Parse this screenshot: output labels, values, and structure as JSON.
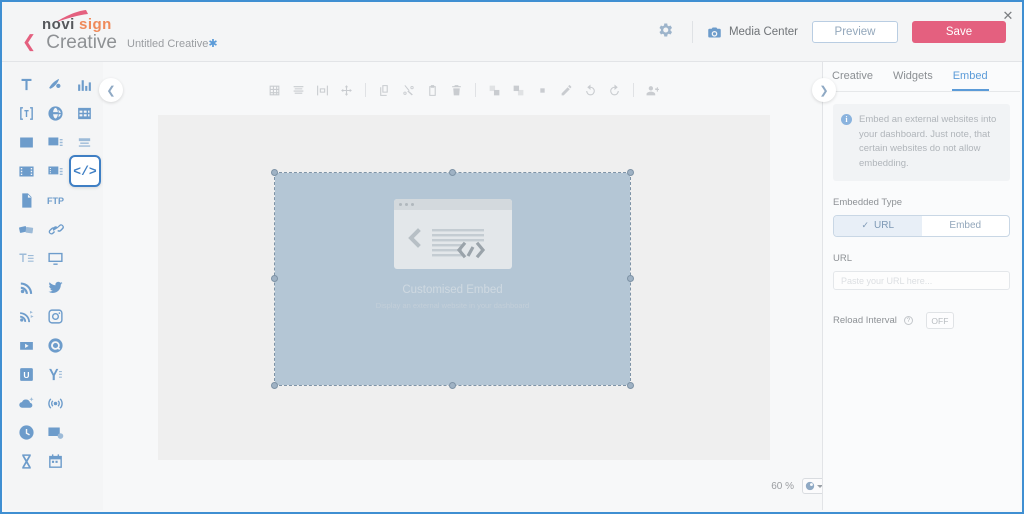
{
  "window": {
    "close_label": "✕",
    "accent_blue": "#3f8fd2",
    "accent_pink": "#e4607f"
  },
  "header": {
    "logo_primary": "novi",
    "logo_secondary": "sign",
    "back_chevron": "❮",
    "title": "Creative",
    "doc_name": "Untitled Creative",
    "doc_modified_mark": "✱",
    "gear_icon": "gear-icon",
    "media_center_label": "Media Center",
    "media_center_icon": "camera-icon",
    "preview_label": "Preview",
    "save_label": "Save"
  },
  "sidebar": {
    "items": [
      {
        "name": "text-widget",
        "icon": "text-icon",
        "selected": false
      },
      {
        "name": "paint-widget",
        "icon": "paint-icon",
        "selected": false
      },
      {
        "name": "chart-widget",
        "icon": "chart-icon",
        "selected": false
      },
      {
        "name": "text3d-widget",
        "icon": "text-3d-icon",
        "selected": false
      },
      {
        "name": "web-widget",
        "icon": "globe-icon",
        "selected": false
      },
      {
        "name": "table-widget",
        "icon": "table-icon",
        "selected": false
      },
      {
        "name": "image-widget",
        "icon": "image-icon",
        "selected": false
      },
      {
        "name": "slideshow-widget",
        "icon": "slideshow-icon",
        "selected": false
      },
      {
        "name": "banner-widget",
        "icon": "banner-icon",
        "selected": false
      },
      {
        "name": "video-widget",
        "icon": "video-icon",
        "selected": false
      },
      {
        "name": "video-playlist-widget",
        "icon": "video-playlist-icon",
        "selected": false
      },
      {
        "name": "embed-widget",
        "icon": "code-icon",
        "glyph": "</>",
        "selected": true
      },
      {
        "name": "document-widget",
        "icon": "document-icon",
        "selected": false
      },
      {
        "name": "ftp-widget",
        "icon": "ftp-icon",
        "glyph": "FTP",
        "selected": false
      },
      {
        "name": "cards-widget",
        "icon": "cards-icon",
        "selected": false
      },
      {
        "name": "link-widget",
        "icon": "link-icon",
        "selected": false
      },
      {
        "name": "ticker-widget",
        "icon": "ticker-text-icon",
        "selected": false
      },
      {
        "name": "screen-widget",
        "icon": "monitor-icon",
        "selected": false
      },
      {
        "name": "rss-widget",
        "icon": "rss-icon",
        "selected": false
      },
      {
        "name": "twitter-widget",
        "icon": "twitter-icon",
        "selected": false
      },
      {
        "name": "rss-feed-widget",
        "icon": "rss-alt-icon",
        "selected": false
      },
      {
        "name": "instagram-widget",
        "icon": "instagram-icon",
        "selected": false
      },
      {
        "name": "youtube-widget",
        "icon": "youtube-icon",
        "selected": false
      },
      {
        "name": "quora-widget",
        "icon": "quora-icon",
        "selected": false
      },
      {
        "name": "untappd-widget",
        "icon": "untappd-icon",
        "glyph": "U",
        "selected": false
      },
      {
        "name": "yammer-widget",
        "icon": "yammer-icon",
        "glyph": "y",
        "selected": false
      },
      {
        "name": "weather-widget",
        "icon": "weather-icon",
        "selected": false
      },
      {
        "name": "live-stream-widget",
        "icon": "broadcast-icon",
        "selected": false
      },
      {
        "name": "clock-widget",
        "icon": "clock-icon",
        "selected": false
      },
      {
        "name": "gallery-widget",
        "icon": "photo-gallery-icon",
        "selected": false
      },
      {
        "name": "countdown-widget",
        "icon": "hourglass-icon",
        "selected": false
      },
      {
        "name": "calendar-widget",
        "icon": "calendar-icon",
        "selected": false
      }
    ]
  },
  "toolbar": {
    "items": [
      {
        "name": "grid-button",
        "icon": "grid-icon"
      },
      {
        "name": "align-button",
        "icon": "align-icon"
      },
      {
        "name": "distribute-button",
        "icon": "distribute-icon"
      },
      {
        "name": "move-button",
        "icon": "move-icon"
      },
      {
        "name": "sep1",
        "icon": "separator"
      },
      {
        "name": "copy-button",
        "icon": "copy-icon"
      },
      {
        "name": "cut-button",
        "icon": "scissors-icon"
      },
      {
        "name": "paste-button",
        "icon": "paste-icon"
      },
      {
        "name": "delete-button",
        "icon": "trash-icon"
      },
      {
        "name": "sep2",
        "icon": "separator"
      },
      {
        "name": "bring-front-button",
        "icon": "bring-to-front-icon"
      },
      {
        "name": "send-back-button",
        "icon": "send-to-back-icon"
      },
      {
        "name": "resize-button",
        "icon": "resize-icon"
      },
      {
        "name": "edit-button",
        "icon": "pencil-icon"
      },
      {
        "name": "undo-button",
        "icon": "undo-icon"
      },
      {
        "name": "redo-button",
        "icon": "redo-icon"
      },
      {
        "name": "sep3",
        "icon": "separator"
      },
      {
        "name": "add-user-button",
        "icon": "add-user-icon"
      }
    ],
    "collapse_left_icon": "❮",
    "collapse_right_icon": "❯"
  },
  "canvas": {
    "widget": {
      "title": "Customised Embed",
      "subtitle": "Display an external website in your dashboard",
      "fill_color": "#b4c6d5"
    },
    "zoom_value": "60 %",
    "zoom_settings_icon": "gear-icon"
  },
  "panel": {
    "tabs": [
      {
        "label": "Creative",
        "active": false
      },
      {
        "label": "Widgets",
        "active": false
      },
      {
        "label": "Embed",
        "active": true
      }
    ],
    "info": {
      "icon_glyph": "i",
      "text": "Embed an external websites into your dashboard. Just note, that certain websites do not allow embedding."
    },
    "embedded_type": {
      "label": "Embedded Type",
      "options": [
        {
          "label": "URL",
          "selected": true,
          "check": "✓"
        },
        {
          "label": "Embed",
          "selected": false
        }
      ]
    },
    "url": {
      "label": "URL",
      "value": "",
      "placeholder": "Paste your URL here..."
    },
    "reload_interval": {
      "label": "Reload Interval",
      "help_icon": "?",
      "state_label": "OFF"
    }
  }
}
